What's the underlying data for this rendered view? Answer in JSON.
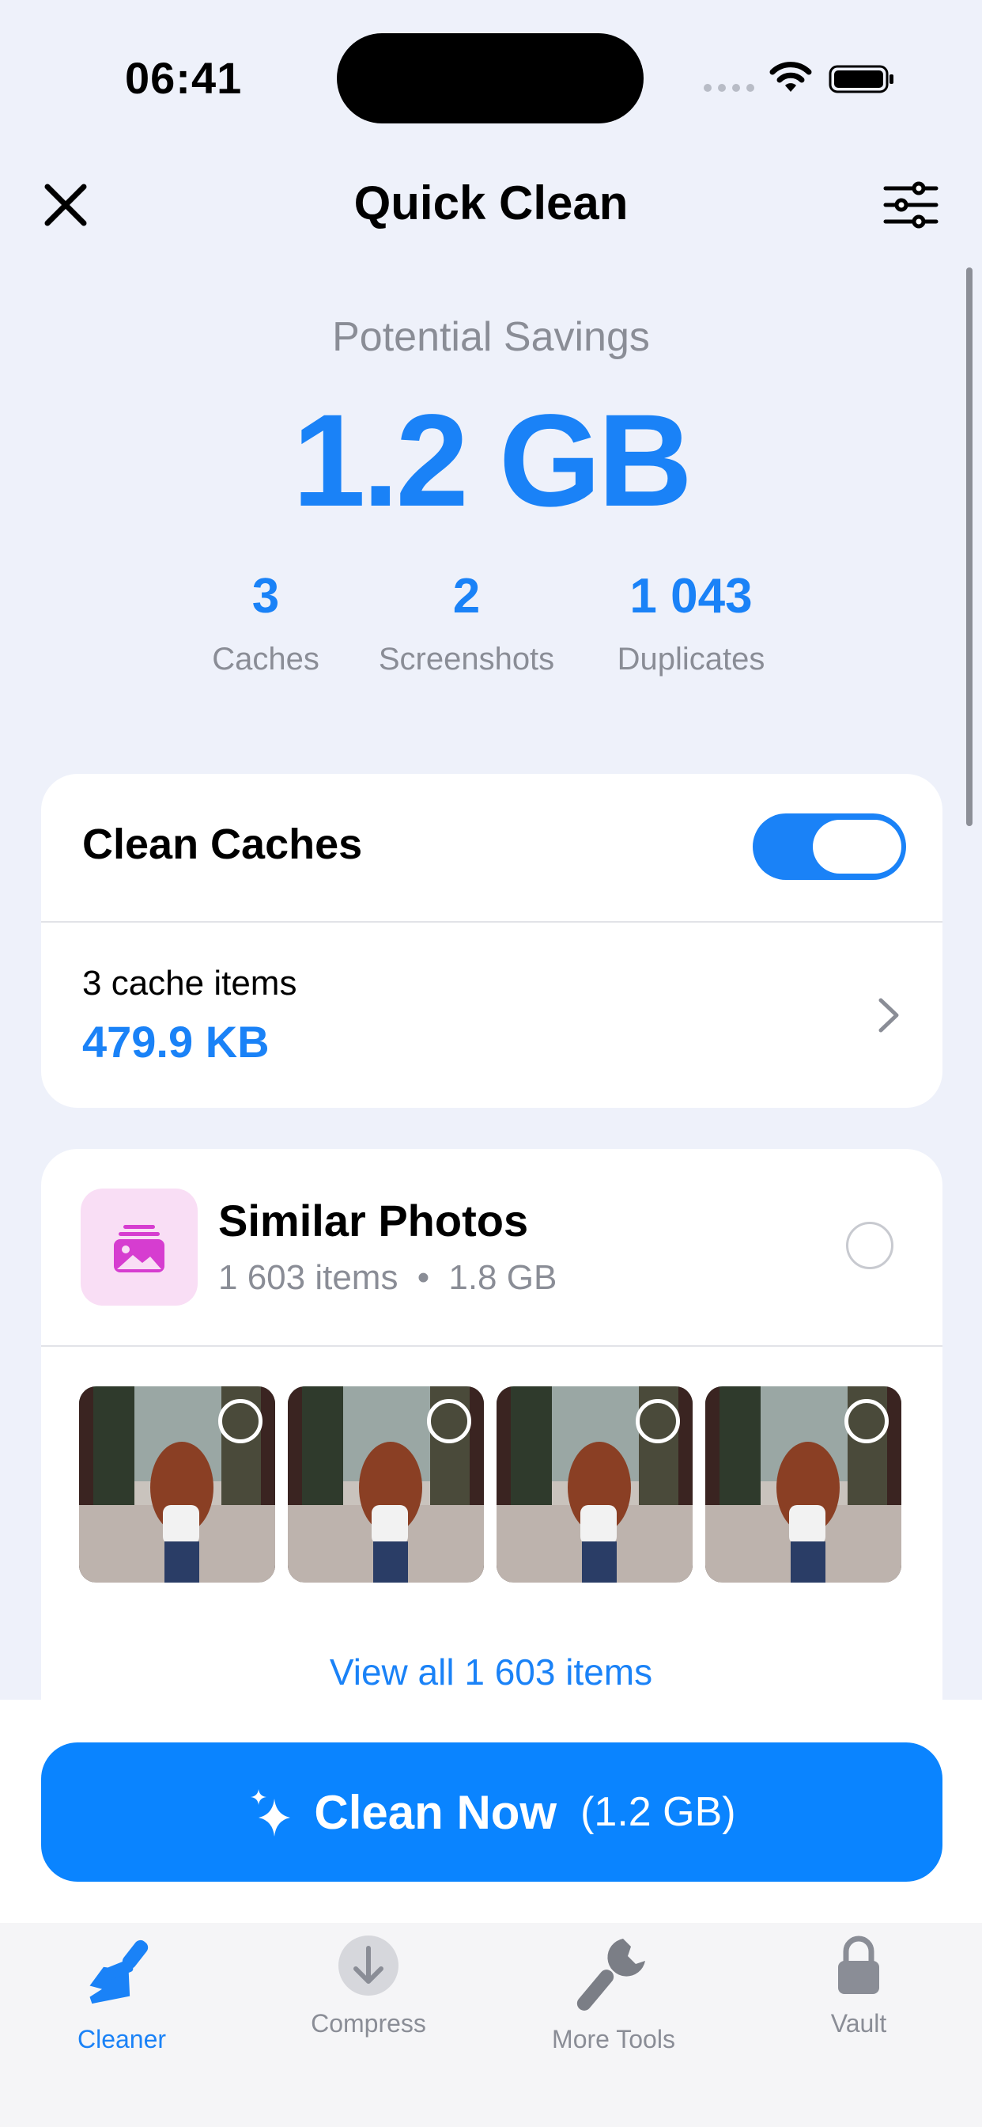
{
  "status_bar": {
    "time": "06:41"
  },
  "header": {
    "title": "Quick Clean"
  },
  "savings": {
    "label": "Potential Savings",
    "value": "1.2 GB",
    "stats": [
      {
        "number": "3",
        "label": "Caches"
      },
      {
        "number": "2",
        "label": "Screenshots"
      },
      {
        "number": "1 043",
        "label": "Duplicates"
      }
    ]
  },
  "caches_card": {
    "title": "Clean Caches",
    "toggle_on": true,
    "items_text": "3 cache items",
    "size": "479.9 KB"
  },
  "similar_card": {
    "title": "Similar Photos",
    "count": "1 603 items",
    "size": "1.8 GB",
    "separator": "•",
    "view_all": "View all 1 603 items"
  },
  "clean_button": {
    "label": "Clean Now",
    "size": "(1.2 GB)"
  },
  "tabs": [
    {
      "label": "Cleaner",
      "icon": "broom-icon",
      "active": true
    },
    {
      "label": "Compress",
      "icon": "download-arrow-icon",
      "active": false
    },
    {
      "label": "More Tools",
      "icon": "wrench-icon",
      "active": false
    },
    {
      "label": "Vault",
      "icon": "lock-icon",
      "active": false
    }
  ],
  "colors": {
    "accent": "#1a82f7",
    "button": "#0a84ff",
    "background": "#eef1fa"
  }
}
